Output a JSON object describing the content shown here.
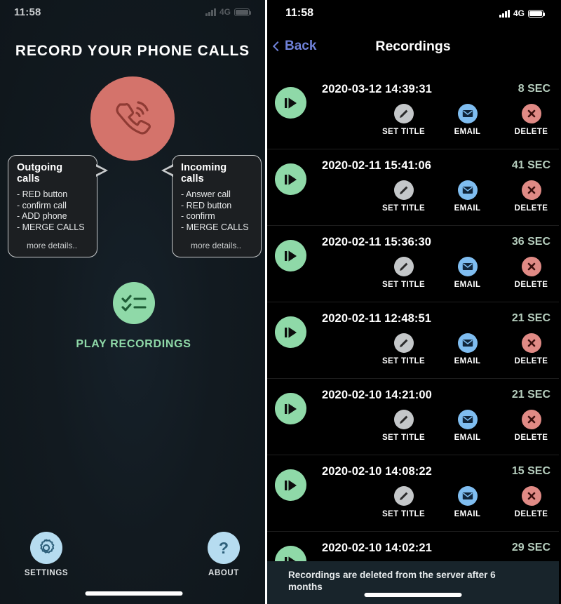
{
  "colors": {
    "accent_green": "#8fd9a8",
    "accent_red": "#d4736b",
    "accent_blue": "#b6dcf0",
    "back_blue": "#6f81d8",
    "email_blue": "#7fbdf0",
    "delete_red": "#e08a85",
    "set_title_gray": "#c4c7c9",
    "left_bg": "#131c22",
    "right_bg": "#000000",
    "toast_bg": "#18242b"
  },
  "left_screen": {
    "status_bar": {
      "time": "11:58",
      "network": "4G",
      "signal_icon": "signal-bars-icon",
      "battery_icon": "battery-icon"
    },
    "title": "RECORD YOUR PHONE CALLS",
    "phone_icon": "phone-ring-icon",
    "callouts": [
      {
        "id": "outgoing",
        "heading": "Outgoing calls",
        "items": [
          "- RED button",
          "- confirm call",
          "- ADD phone",
          "- MERGE CALLS"
        ],
        "more": "more details.."
      },
      {
        "id": "incoming",
        "heading": "Incoming calls",
        "items": [
          "- Answer call",
          "- RED button",
          "- confirm",
          "- MERGE CALLS"
        ],
        "more": "more details.."
      }
    ],
    "play_recordings": {
      "label": "PLAY RECORDINGS",
      "icon": "checklist-icon"
    },
    "bottom_nav": [
      {
        "id": "settings",
        "label": "SETTINGS",
        "icon": "gear-icon"
      },
      {
        "id": "about",
        "label": "ABOUT",
        "icon": "question-mark-icon"
      }
    ]
  },
  "right_screen": {
    "status_bar": {
      "time": "11:58",
      "network": "4G",
      "signal_icon": "signal-bars-icon",
      "battery_icon": "battery-icon"
    },
    "nav": {
      "back_label": "Back",
      "back_icon": "chevron-left-icon",
      "title": "Recordings"
    },
    "action_labels": {
      "set_title": "SET TITLE",
      "email": "EMAIL",
      "delete": "DELETE"
    },
    "action_icons": {
      "set_title": "pencil-icon",
      "email": "envelope-icon",
      "delete": "x-circle-icon",
      "play": "play-icon"
    },
    "recordings": [
      {
        "date": "2020-03-12 14:39:31",
        "duration": "8 SEC"
      },
      {
        "date": "2020-02-11 15:41:06",
        "duration": "41 SEC"
      },
      {
        "date": "2020-02-11 15:36:30",
        "duration": "36 SEC"
      },
      {
        "date": "2020-02-11 12:48:51",
        "duration": "21 SEC"
      },
      {
        "date": "2020-02-10 14:21:00",
        "duration": "21 SEC"
      },
      {
        "date": "2020-02-10 14:08:22",
        "duration": "15 SEC"
      },
      {
        "date": "2020-02-10 14:02:21",
        "duration": "29 SEC"
      }
    ],
    "toast": "Recordings are deleted from the server after 6 months"
  }
}
